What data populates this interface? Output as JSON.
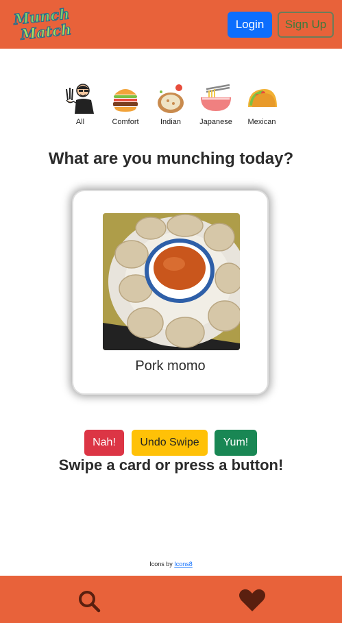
{
  "header": {
    "logo_line1": "Munch",
    "logo_line2": "Match",
    "login_label": "Login",
    "signup_label": "Sign Up",
    "colors": {
      "bar": "#e8623a",
      "login": "#0d6efd"
    }
  },
  "categories": [
    {
      "label": "All",
      "icon": "person-waving-icon"
    },
    {
      "label": "Comfort",
      "icon": "burger-icon"
    },
    {
      "label": "Indian",
      "icon": "curry-bowl-icon"
    },
    {
      "label": "Japanese",
      "icon": "ramen-icon"
    },
    {
      "label": "Mexican",
      "icon": "taco-icon"
    }
  ],
  "main": {
    "question": "What are you munching today?",
    "card": {
      "title": "Pork momo",
      "image": "momo-dumplings-photo"
    },
    "actions": {
      "nah": "Nah!",
      "undo": "Undo Swipe",
      "yum": "Yum!"
    },
    "hint": "Swipe a card or press a button!"
  },
  "credit": {
    "prefix": "Icons by",
    "link": "Icons8"
  },
  "footer": {
    "icons": [
      "search-icon",
      "heart-icon"
    ]
  }
}
